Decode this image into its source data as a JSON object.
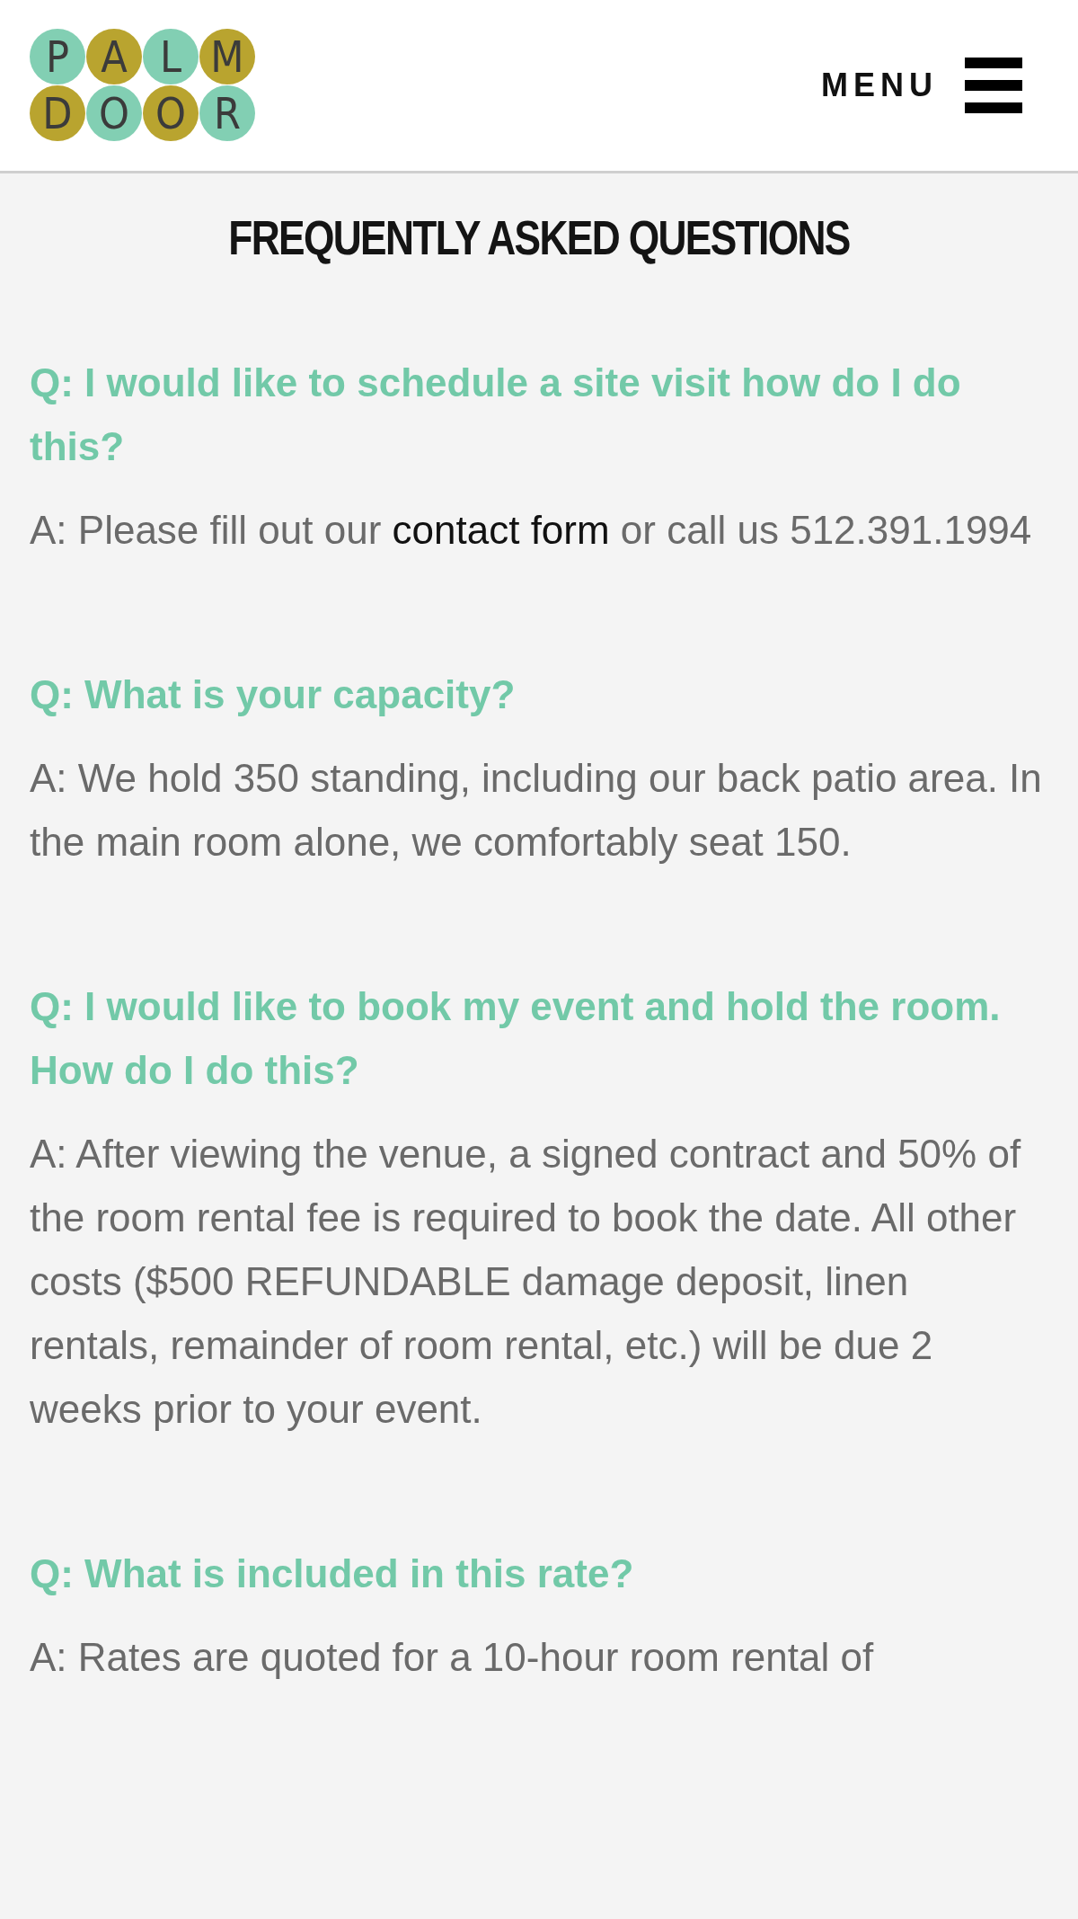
{
  "logo": {
    "rows": [
      [
        "P",
        "A",
        "L",
        "M"
      ],
      [
        "D",
        "O",
        "O",
        "R"
      ]
    ]
  },
  "menu": {
    "label": "MENU"
  },
  "title": "FREQUENTLY ASKED QUESTIONS",
  "faqs": [
    {
      "question": "Q: I would like to schedule a site visit how do I do this?",
      "answer": [
        {
          "kind": "text",
          "text": "A: Please fill out our "
        },
        {
          "kind": "link",
          "text": "contact form"
        },
        {
          "kind": "text",
          "text": " or call us 512.391.1994"
        }
      ]
    },
    {
      "question": "Q: What is your capacity?",
      "answer": [
        {
          "kind": "text",
          "text": "A: We hold 350 standing, including our back patio area. In the main room alone, we comfortably seat 150."
        }
      ]
    },
    {
      "question": "Q: I would like to book my event and hold the room. How do I do this?",
      "answer": [
        {
          "kind": "text",
          "text": "A: After viewing the venue, a signed contract and 50% of the room rental fee is required to book the date. All other costs ($500 REFUNDABLE damage deposit, linen rentals, remainder of room rental, etc.) will be due 2 weeks prior to your event."
        }
      ]
    },
    {
      "question": "Q: What is included in this rate?",
      "answer": [
        {
          "kind": "text",
          "text": "A: Rates are quoted for a 10-hour room rental of"
        }
      ]
    }
  ]
}
